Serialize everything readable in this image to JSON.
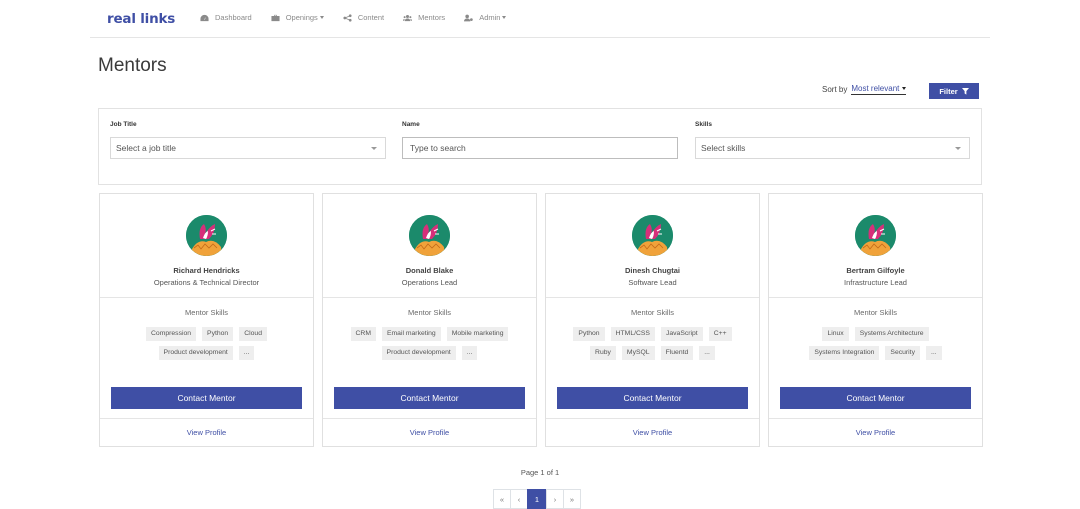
{
  "brand": "real links",
  "nav": [
    {
      "label": "Dashboard",
      "icon": "dashboard-icon",
      "dropdown": false
    },
    {
      "label": "Openings",
      "icon": "briefcase-icon",
      "dropdown": true
    },
    {
      "label": "Content",
      "icon": "share-icon",
      "dropdown": false
    },
    {
      "label": "Mentors",
      "icon": "users-icon",
      "dropdown": false
    },
    {
      "label": "Admin",
      "icon": "user-cog-icon",
      "dropdown": true
    }
  ],
  "page": {
    "title": "Mentors"
  },
  "sort": {
    "label": "Sort by",
    "value": "Most relevant"
  },
  "filter_button": {
    "label": "Filter",
    "icon": "filter-icon"
  },
  "filters": {
    "job_title": {
      "label": "Job Title",
      "placeholder": "Select a job title"
    },
    "name": {
      "label": "Name",
      "placeholder": "Type to search"
    },
    "skills": {
      "label": "Skills",
      "placeholder": "Select skills"
    }
  },
  "skills_heading": "Mentor Skills",
  "contact_label": "Contact Mentor",
  "profile_label": "View Profile",
  "mentors": [
    {
      "name": "Richard Hendricks",
      "role": "Operations & Technical Director",
      "skills": [
        "Compression",
        "Python",
        "Cloud",
        "Product development",
        "..."
      ]
    },
    {
      "name": "Donald Blake",
      "role": "Operations Lead",
      "skills": [
        "CRM",
        "Email marketing",
        "Mobile marketing",
        "Product development",
        "..."
      ]
    },
    {
      "name": "Dinesh Chugtai",
      "role": "Software Lead",
      "skills": [
        "Python",
        "HTML/CSS",
        "JavaScript",
        "C++",
        "Ruby",
        "MySQL",
        "Fluentd",
        "..."
      ]
    },
    {
      "name": "Bertram Gilfoyle",
      "role": "Infrastructure Lead",
      "skills": [
        "Linux",
        "Systems Architecture",
        "Systems Integration",
        "Security",
        "..."
      ]
    }
  ],
  "pagination": {
    "info": "Page 1 of 1",
    "first": "«",
    "prev": "‹",
    "current": "1",
    "next": "›",
    "last": "»"
  },
  "colors": {
    "accent": "#3f4fa5",
    "avatar_bg": "#1b8a6b"
  }
}
